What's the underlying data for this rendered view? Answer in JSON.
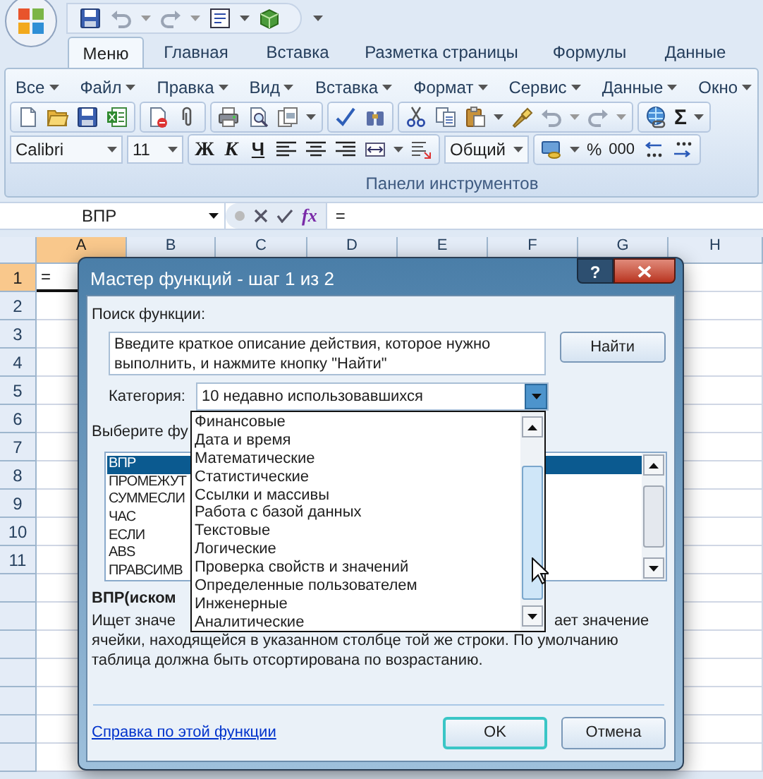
{
  "ribbon_tabs": [
    {
      "label": "Меню",
      "selected": true
    },
    {
      "label": "Главная",
      "selected": false
    },
    {
      "label": "Вставка",
      "selected": false
    },
    {
      "label": "Разметка страницы",
      "selected": false
    },
    {
      "label": "Формулы",
      "selected": false
    },
    {
      "label": "Данные",
      "selected": false
    }
  ],
  "classic_menu": [
    "Все",
    "Файл",
    "Правка",
    "Вид",
    "Вставка",
    "Формат",
    "Сервис",
    "Данные",
    "Окно"
  ],
  "toolbar": {
    "sum_button": "Σ",
    "font_name": "Calibri",
    "font_size": "11",
    "bold": "Ж",
    "italic": "К",
    "underline": "Ч",
    "number_format": "Общий",
    "percent": "%",
    "thousands": "000",
    "group_label": "Панели инструментов"
  },
  "formula_bar": {
    "name_box": "ВПР",
    "function_button": "fx",
    "formula": "="
  },
  "sheet": {
    "columns": [
      {
        "label": "A",
        "selected": true
      },
      {
        "label": "B",
        "selected": false
      },
      {
        "label": "C",
        "selected": false
      },
      {
        "label": "D",
        "selected": false
      },
      {
        "label": "E",
        "selected": false
      },
      {
        "label": "F",
        "selected": false
      },
      {
        "label": "G",
        "selected": false
      },
      {
        "label": "H",
        "selected": false
      }
    ],
    "rows": [
      {
        "label": "1",
        "selected": true
      },
      {
        "label": "2",
        "selected": false
      },
      {
        "label": "3",
        "selected": false
      },
      {
        "label": "4",
        "selected": false
      },
      {
        "label": "5",
        "selected": false
      },
      {
        "label": "6",
        "selected": false
      },
      {
        "label": "7",
        "selected": false
      },
      {
        "label": "8",
        "selected": false
      },
      {
        "label": "9",
        "selected": false
      },
      {
        "label": "10",
        "selected": false
      },
      {
        "label": "11",
        "selected": false
      }
    ],
    "active_cell": "="
  },
  "dialog": {
    "title": "Мастер функций - шаг 1 из 2",
    "help_button": "?",
    "search_label": "Поиск функции:",
    "search_text": "Введите краткое описание действия, которое нужно выполнить, и нажмите кнопку \"Найти\"",
    "find_button": "Найти",
    "category_label": "Категория:",
    "category_value": "10 недавно использовавшихся",
    "select_label": "Выберите фу",
    "functions": [
      {
        "label": "ВПР",
        "selected": true
      },
      {
        "label": "ПРОМЕЖУТ",
        "selected": false
      },
      {
        "label": "СУММЕСЛИ",
        "selected": false
      },
      {
        "label": "ЧАС",
        "selected": false
      },
      {
        "label": "ЕСЛИ",
        "selected": false
      },
      {
        "label": "ABS",
        "selected": false
      },
      {
        "label": "ПРАВСИМВ",
        "selected": false
      }
    ],
    "signature": "ВПР(иском",
    "description": [
      "Ищет значе",
      "ает значение",
      "ячейки, находящейся в указанном столбце той же строки. По умолчанию",
      "таблица должна быть отсортирована по возрастанию."
    ],
    "help_link": "Справка по этой функции",
    "ok_button": "OK",
    "cancel_button": "Отмена",
    "category_dropdown": [
      "Финансовые",
      "Дата и время",
      "Математические",
      "Статистические",
      "Ссылки и массивы",
      "Работа с базой данных",
      "Текстовые",
      "Логические",
      "Проверка свойств и значений",
      "Определенные пользователем",
      "Инженерные",
      "Аналитические"
    ]
  }
}
